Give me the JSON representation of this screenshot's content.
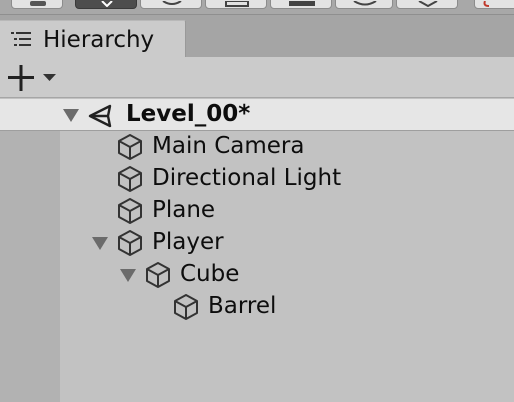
{
  "panel": {
    "tab_title": "Hierarchy",
    "tab_icon": "list-icon",
    "add_button_icon": "plus-icon",
    "add_dropdown_icon": "caret-down-icon"
  },
  "toolbar": {
    "icons": [
      "hand-icon",
      "move-icon",
      "rotate-icon",
      "scale-icon",
      "rect-icon",
      "transform-icon",
      "custom-tool-icon",
      "snap-icon"
    ]
  },
  "hierarchy": {
    "scene": {
      "name": "Level_00*",
      "icon": "unity-logo-icon",
      "expanded": true
    },
    "items": [
      {
        "name": "Main Camera",
        "icon": "cube-icon",
        "depth": 1,
        "expandable": false
      },
      {
        "name": "Directional Light",
        "icon": "cube-icon",
        "depth": 1,
        "expandable": false
      },
      {
        "name": "Plane",
        "icon": "cube-icon",
        "depth": 1,
        "expandable": false
      },
      {
        "name": "Player",
        "icon": "cube-icon",
        "depth": 1,
        "expandable": true,
        "expanded": true
      },
      {
        "name": "Cube",
        "icon": "cube-icon",
        "depth": 2,
        "expandable": true,
        "expanded": true
      },
      {
        "name": "Barrel",
        "icon": "cube-icon",
        "depth": 3,
        "expandable": false
      }
    ]
  },
  "colors": {
    "panel_bg": "#c2c2c2",
    "header_bg": "#cbcbcb",
    "scene_row_bg": "#e6e6e6",
    "text": "#0d0d0d",
    "icon": "#333333"
  }
}
